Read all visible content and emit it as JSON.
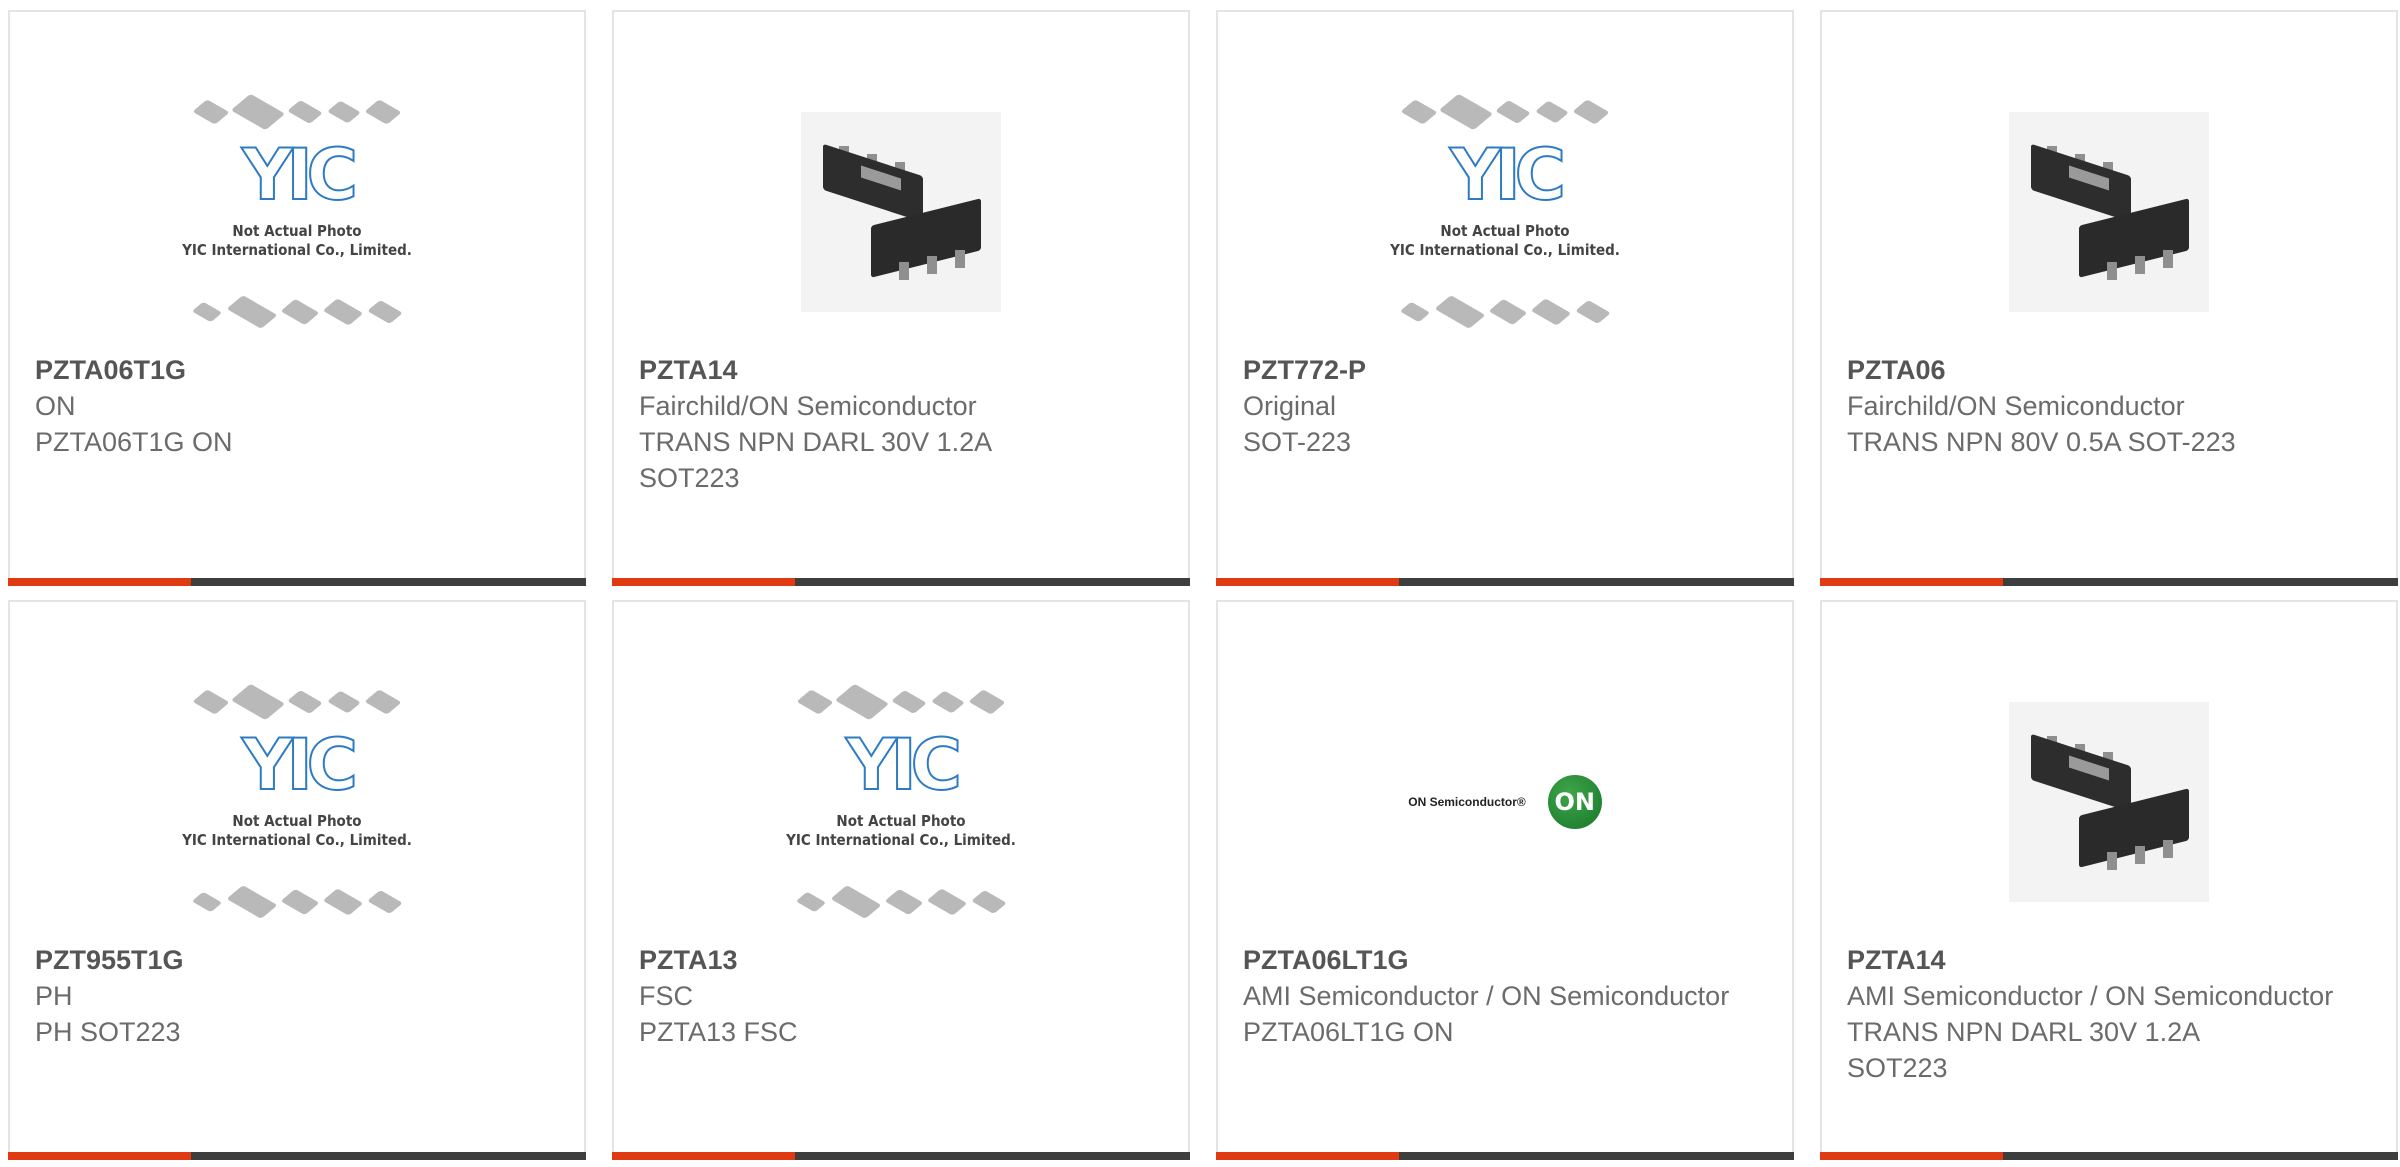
{
  "products": [
    {
      "part": "PZTA06T1G",
      "maker": "ON",
      "desc": [
        "PZTA06T1G ON"
      ],
      "image": "placeholder"
    },
    {
      "part": "PZTA14",
      "maker": "Fairchild/ON Semiconductor",
      "desc": [
        "TRANS NPN DARL 30V 1.2A",
        "SOT223"
      ],
      "image": "transistor"
    },
    {
      "part": "PZT772-P",
      "maker": "Original",
      "desc": [
        "SOT-223"
      ],
      "image": "placeholder"
    },
    {
      "part": "PZTA06",
      "maker": "Fairchild/ON Semiconductor",
      "desc": [
        "TRANS NPN 80V 0.5A SOT-223"
      ],
      "image": "transistor"
    },
    {
      "part": "PZT955T1G",
      "maker": "PH",
      "desc": [
        "PH SOT223"
      ],
      "image": "placeholder"
    },
    {
      "part": "PZTA13",
      "maker": "FSC",
      "desc": [
        "PZTA13 FSC"
      ],
      "image": "placeholder"
    },
    {
      "part": "PZTA06LT1G",
      "maker": "AMI Semiconductor / ON Semiconductor",
      "desc": [
        "PZTA06LT1G ON"
      ],
      "image": "onsemi-logo"
    },
    {
      "part": "PZTA14",
      "maker": "AMI Semiconductor / ON Semiconductor",
      "desc": [
        "TRANS NPN DARL 30V 1.2A",
        "SOT223"
      ],
      "image": "transistor"
    }
  ],
  "placeholder": {
    "logo_text": "YIC",
    "caption_line1": "Not Actual Photo",
    "caption_line2": "YIC International Co., Limited."
  },
  "onsemi": {
    "word": "ON Semiconductor®",
    "mark": "ON"
  },
  "colors": {
    "accent": "#e03a12",
    "bar": "#3e3e3e",
    "border": "#e4e4e4",
    "text": "#6b6b6b"
  }
}
